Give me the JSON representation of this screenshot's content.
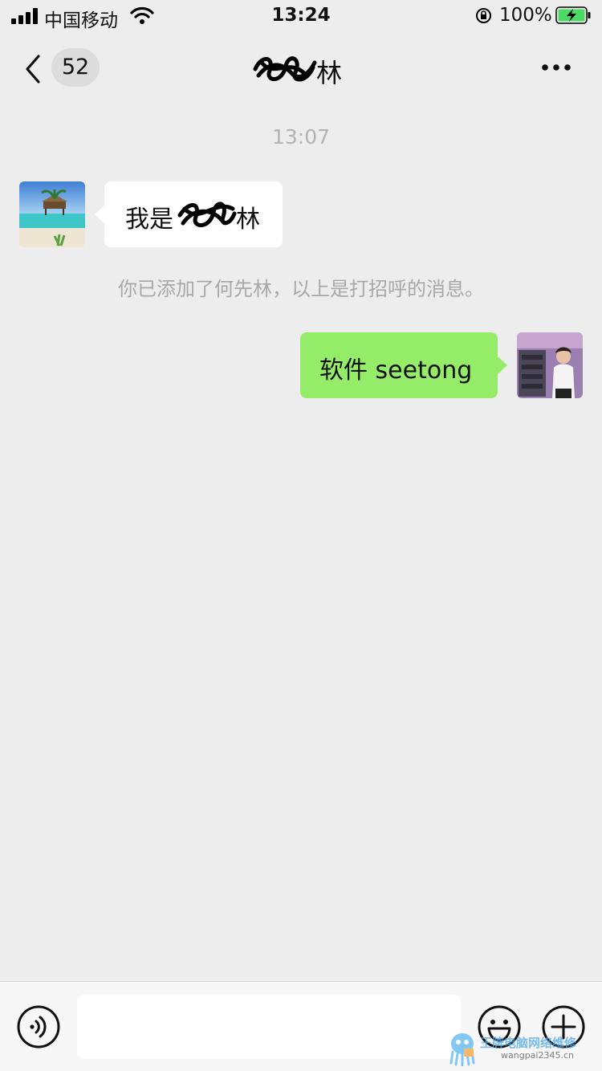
{
  "status_bar": {
    "carrier": "中国移动",
    "time": "13:24",
    "battery_percent": "100%",
    "icons": [
      "signal-icon",
      "wifi-icon",
      "rotation-lock-icon",
      "battery-charging-icon"
    ]
  },
  "nav": {
    "unread_count": "52",
    "title_visible_text": "林",
    "icons": [
      "back-chevron-icon",
      "more-dots-icon"
    ]
  },
  "chat": {
    "time_divider": "13:07",
    "messages": [
      {
        "direction": "incoming",
        "text_prefix": "我是",
        "text_suffix": "林"
      },
      {
        "direction": "outgoing",
        "text": "软件 seetong"
      }
    ],
    "system_tip": "你已添加了何先林，以上是打招呼的消息。"
  },
  "input_bar": {
    "text_value": "",
    "icons": [
      "voice-icon",
      "emoji-icon",
      "plus-icon"
    ]
  },
  "watermark": {
    "line1": "王牌电脑网络维修",
    "line2": "wangpai2345.cn"
  },
  "colors": {
    "background": "#ededed",
    "outgoing_bubble": "#95ec69",
    "incoming_bubble": "#ffffff",
    "muted_text": "#b3b3b3"
  }
}
